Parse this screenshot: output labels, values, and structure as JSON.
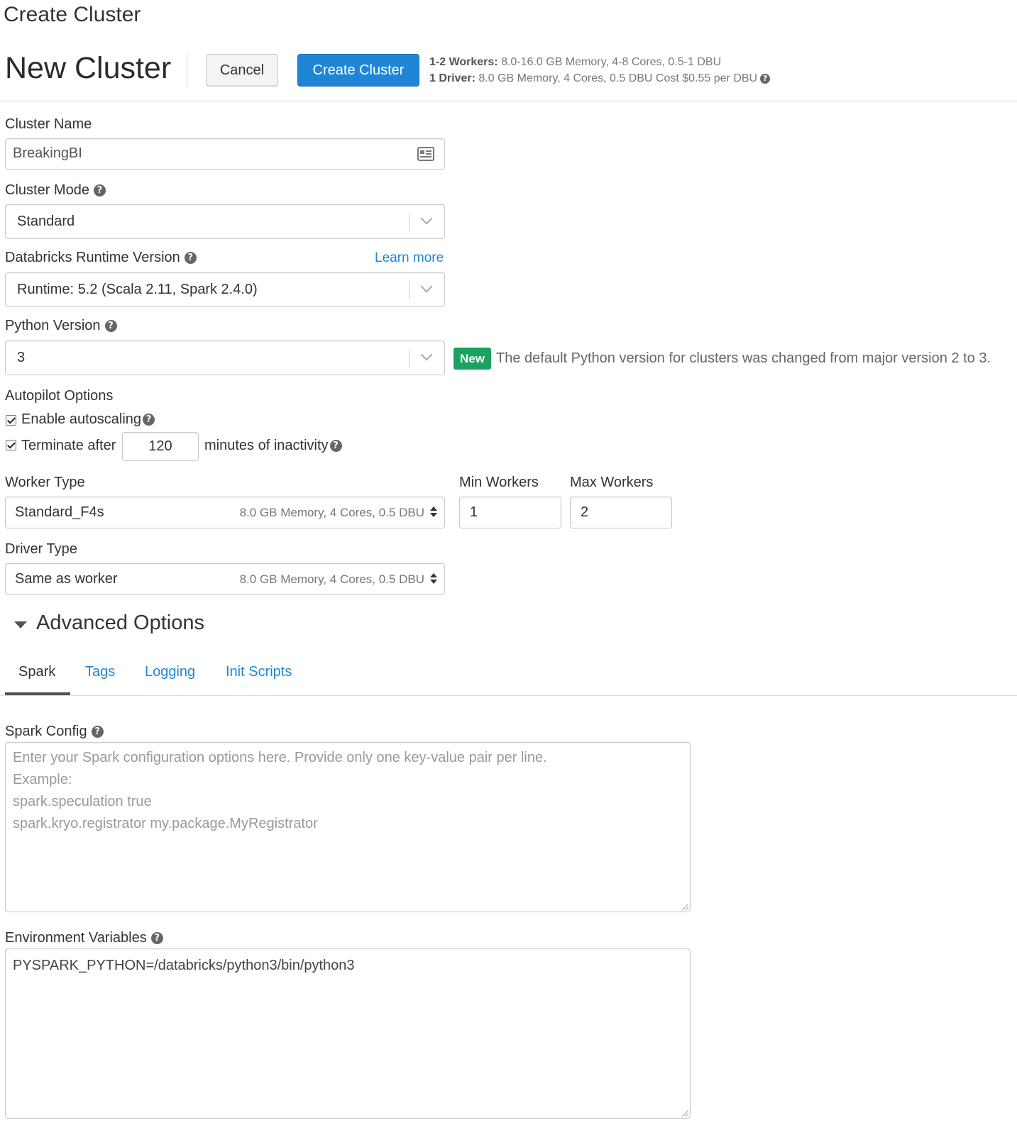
{
  "page": {
    "title": "Create Cluster"
  },
  "header": {
    "cluster_title": "New Cluster",
    "cancel_label": "Cancel",
    "create_label": "Create Cluster",
    "summary_workers_bold": "1-2 Workers:",
    "summary_workers_rest": " 8.0-16.0 GB Memory, 4-8 Cores, 0.5-1 DBU",
    "summary_driver_bold": "1 Driver:",
    "summary_driver_rest": " 8.0 GB Memory, 4 Cores, 0.5 DBU Cost $0.55 per DBU"
  },
  "cluster_name": {
    "label": "Cluster Name",
    "value": "BreakingBI"
  },
  "cluster_mode": {
    "label": "Cluster Mode",
    "value": "Standard"
  },
  "runtime": {
    "label": "Databricks Runtime Version",
    "learn_more": "Learn more",
    "value": "Runtime: 5.2 (Scala 2.11, Spark 2.4.0)"
  },
  "python": {
    "label": "Python Version",
    "value": "3",
    "badge": "New",
    "note": "The default Python version for clusters was changed from major version 2 to 3."
  },
  "autopilot": {
    "label": "Autopilot Options",
    "autoscale_label": "Enable autoscaling",
    "autoscale_checked": true,
    "terminate_label": "Terminate after",
    "terminate_checked": true,
    "terminate_minutes": "120",
    "inactivity_label": "minutes of inactivity"
  },
  "worker": {
    "label": "Worker Type",
    "value": "Standard_F4s",
    "spec": "8.0 GB Memory, 4 Cores, 0.5 DBU",
    "min_label": "Min Workers",
    "min_value": "1",
    "max_label": "Max Workers",
    "max_value": "2"
  },
  "driver": {
    "label": "Driver Type",
    "value": "Same as worker",
    "spec": "8.0 GB Memory, 4 Cores, 0.5 DBU"
  },
  "advanced": {
    "title": "Advanced Options",
    "tabs": [
      {
        "label": "Spark",
        "active": true
      },
      {
        "label": "Tags",
        "active": false
      },
      {
        "label": "Logging",
        "active": false
      },
      {
        "label": "Init Scripts",
        "active": false
      }
    ]
  },
  "spark_config": {
    "label": "Spark Config",
    "placeholder": "Enter your Spark configuration options here. Provide only one key-value pair per line.\nExample:\nspark.speculation true\nspark.kryo.registrator my.package.MyRegistrator"
  },
  "env_vars": {
    "label": "Environment Variables",
    "value": "PYSPARK_PYTHON=/databricks/python3/bin/python3"
  },
  "colors": {
    "primary": "#1f86d6",
    "badge_green": "#1aa260",
    "text": "#333333"
  }
}
